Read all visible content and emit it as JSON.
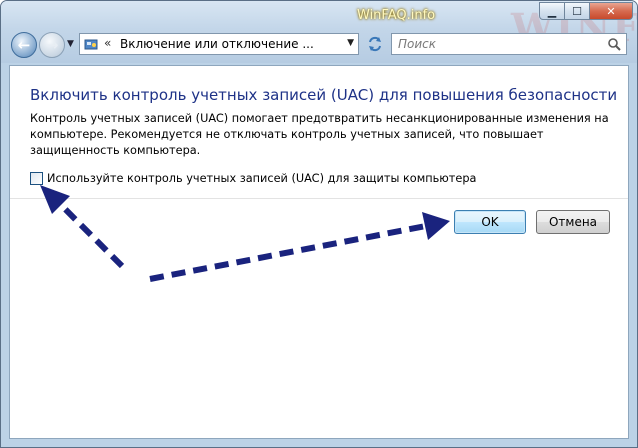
{
  "titlebar": {
    "site_label": "WinFAQ.info",
    "watermark": "WINFAQ",
    "minimize_icon": "minimize-icon",
    "maximize_icon": "maximize-icon",
    "close_icon": "close-icon"
  },
  "navbar": {
    "address": "Включение или отключение ...",
    "address_chevron": "«",
    "search_placeholder": "Поиск"
  },
  "main": {
    "heading": "Включить контроль учетных записей (UAC) для повышения безопасности",
    "description": "Контроль учетных записей (UAC) помогает предотвратить несанкционированные изменения на компьютере.  Рекомендуется не отключать контроль учетных записей, что повышает защищенность компьютера.",
    "checkbox_label": "Используйте контроль учетных записей (UAC) для защиты компьютера",
    "checkbox_checked": false
  },
  "buttons": {
    "ok": "OK",
    "cancel": "Отмена"
  },
  "colors": {
    "heading": "#1e3287",
    "annotation_arrow": "#1a237e",
    "frame": "#bcd2e6"
  }
}
